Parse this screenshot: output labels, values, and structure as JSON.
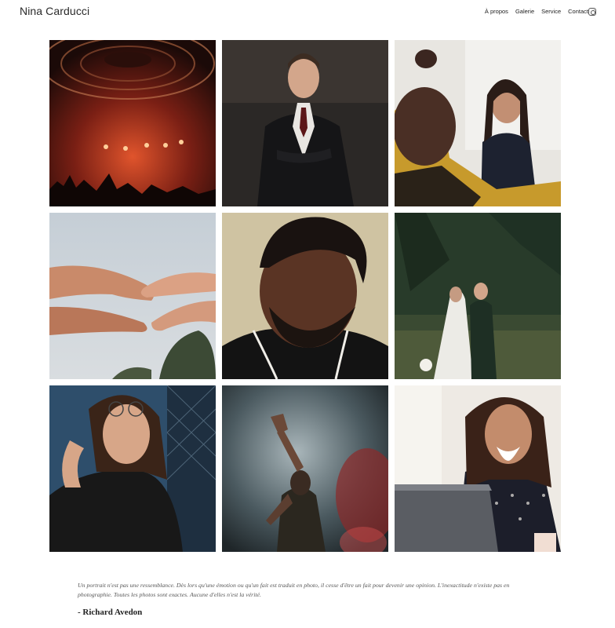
{
  "header": {
    "brand": "Nina Carducci",
    "nav": [
      {
        "label": "À propos"
      },
      {
        "label": "Galerie"
      },
      {
        "label": "Service"
      },
      {
        "label": "Contact"
      }
    ],
    "social_icon": "instagram-icon"
  },
  "gallery": {
    "photos": [
      {
        "subject": "concert-stage"
      },
      {
        "subject": "man-in-suit"
      },
      {
        "subject": "women-meeting"
      },
      {
        "subject": "reaching-hands"
      },
      {
        "subject": "man-portrait"
      },
      {
        "subject": "wedding-couple"
      },
      {
        "subject": "woman-glasses"
      },
      {
        "subject": "concert-hand-raised"
      },
      {
        "subject": "woman-laughing-laptop"
      }
    ]
  },
  "quote": {
    "text": "Un portrait n'est pas une ressemblance. Dès lors qu'une émotion ou qu'un fait est traduit en photo, il cesse d'être un fait pour devenir une opinion. L'inexactitude n'existe pas en photographie. Toutes les photos sont exactes. Aucune d'elles n'est la vérité.",
    "author": "- Richard Avedon"
  },
  "colors": {
    "background": "#ffffff",
    "text": "#222222",
    "quote_text": "#555555"
  }
}
